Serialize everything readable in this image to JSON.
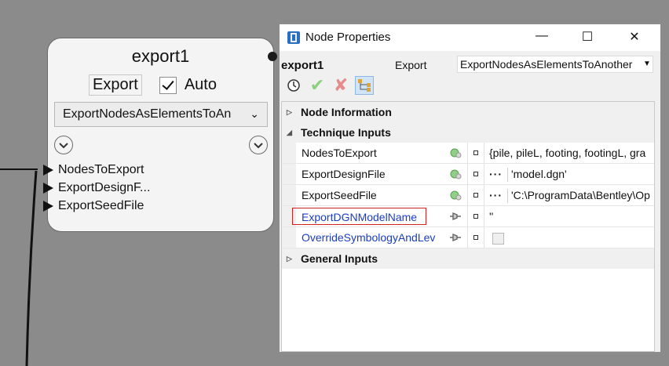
{
  "node": {
    "title": "export1",
    "export_label": "Export",
    "auto_label": "Auto",
    "auto_checked": true,
    "technique_value": "ExportNodesAsElementsToAn",
    "ports": [
      "NodesToExport",
      "ExportDesignF...",
      "ExportSeedFile"
    ]
  },
  "window": {
    "title": "Node Properties",
    "node_name": "export1",
    "node_type": "Export",
    "technique": "ExportNodesAsElementsToAnother",
    "categories": {
      "node_info": "Node Information",
      "technique_inputs": "Technique Inputs",
      "general_inputs": "General Inputs"
    },
    "properties": [
      {
        "name": "NodesToExport",
        "value": "{pile, pileL, footing, footingL, gra",
        "icon": "green-dot-icon"
      },
      {
        "name": "ExportDesignFile",
        "value": "'model.dgn'",
        "icon": "green-dot-icon"
      },
      {
        "name": "ExportSeedFile",
        "value": "'C:\\ProgramData\\Bentley\\Op",
        "icon": "green-dot-icon"
      },
      {
        "name": "ExportDGNModelName",
        "value": "''",
        "icon": "pin-icon"
      },
      {
        "name": "OverrideSymbologyAndLev",
        "value": "",
        "icon": "pin-icon"
      }
    ]
  },
  "colors": {
    "canvas": "#8b8b8b",
    "highlight_border": "#d62020",
    "optional_param": "#1a3cc8",
    "selected_tool": "#cfe4f7"
  }
}
